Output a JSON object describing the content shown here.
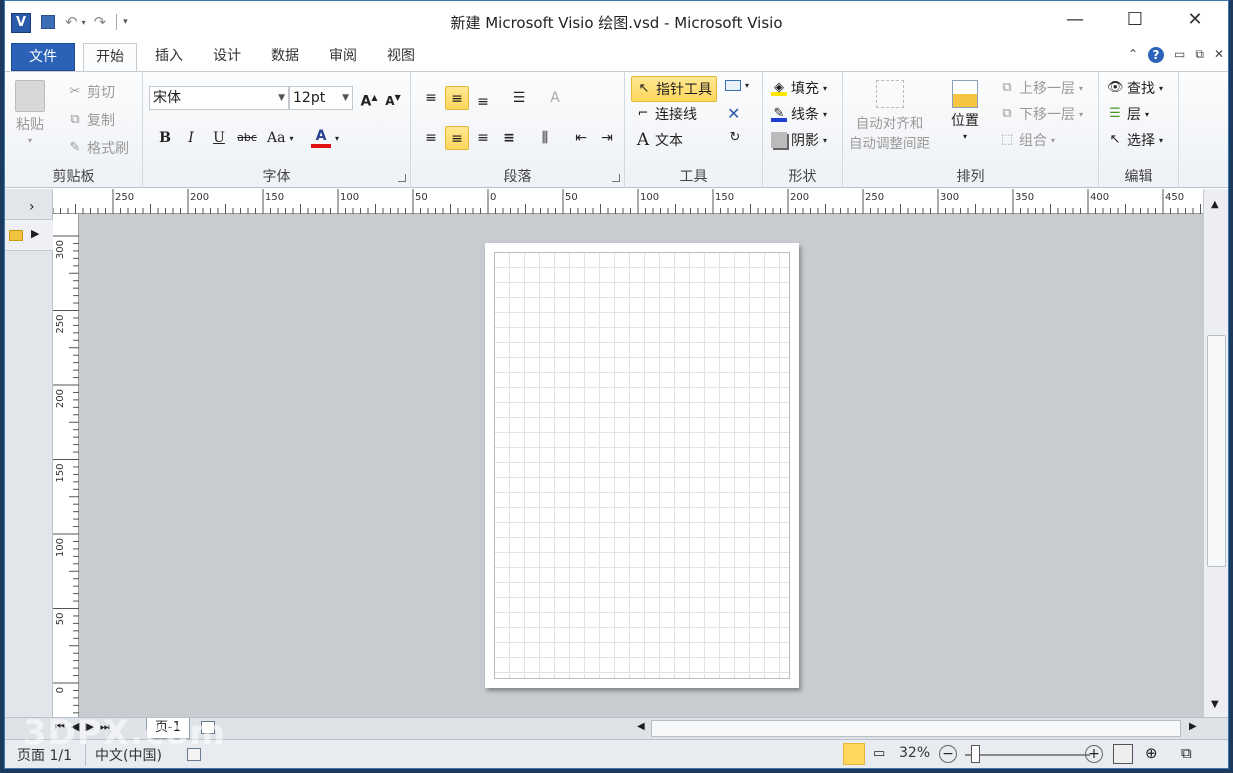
{
  "window": {
    "title": "新建 Microsoft Visio 绘图.vsd - Microsoft Visio",
    "app_logo": "V"
  },
  "qat": {
    "undo": "↶",
    "redo": "↷"
  },
  "tabs": [
    {
      "label": "文件"
    },
    {
      "label": "开始"
    },
    {
      "label": "插入"
    },
    {
      "label": "设计"
    },
    {
      "label": "数据"
    },
    {
      "label": "审阅"
    },
    {
      "label": "视图"
    }
  ],
  "clipboard": {
    "paste": "粘贴",
    "cut": "剪切",
    "copy": "复制",
    "format_painter": "格式刷",
    "label": "剪贴板"
  },
  "font": {
    "name": "宋体",
    "size": "12pt",
    "label": "字体",
    "bold": "B",
    "italic": "I",
    "underline": "U",
    "strike": "abc",
    "case": "Aa",
    "color_letter": "A",
    "grow": "A",
    "shrink": "A"
  },
  "paragraph": {
    "label": "段落"
  },
  "tools": {
    "pointer": "指针工具",
    "connector": "连接线",
    "text": "文本",
    "label": "工具"
  },
  "shape": {
    "fill": "填充",
    "line": "线条",
    "shadow": "阴影",
    "label": "形状"
  },
  "arrange": {
    "auto_align": "自动对齐和",
    "auto_space": "自动调整间距",
    "position": "位置",
    "bring_forward": "上移一层",
    "send_backward": "下移一层",
    "group": "组合",
    "label": "排列"
  },
  "editing": {
    "find": "查找",
    "layer": "层",
    "select": "选择",
    "label": "编辑"
  },
  "hruler_ticks": [
    "250",
    "200",
    "150",
    "100",
    "50",
    "0",
    "50",
    "100",
    "150",
    "200",
    "250",
    "300",
    "350",
    "400",
    "450"
  ],
  "vruler_ticks": [
    "300",
    "250",
    "200",
    "150",
    "100",
    "50",
    "0"
  ],
  "page_tab": "页-1",
  "status": {
    "page": "页面 1/1",
    "language": "中文(中国)",
    "zoom": "32%"
  },
  "colors": {
    "accent": "#2b62b7",
    "selected": "#ffd75a",
    "canvas": "#c8ccd1"
  },
  "watermark": "3DPX.com"
}
